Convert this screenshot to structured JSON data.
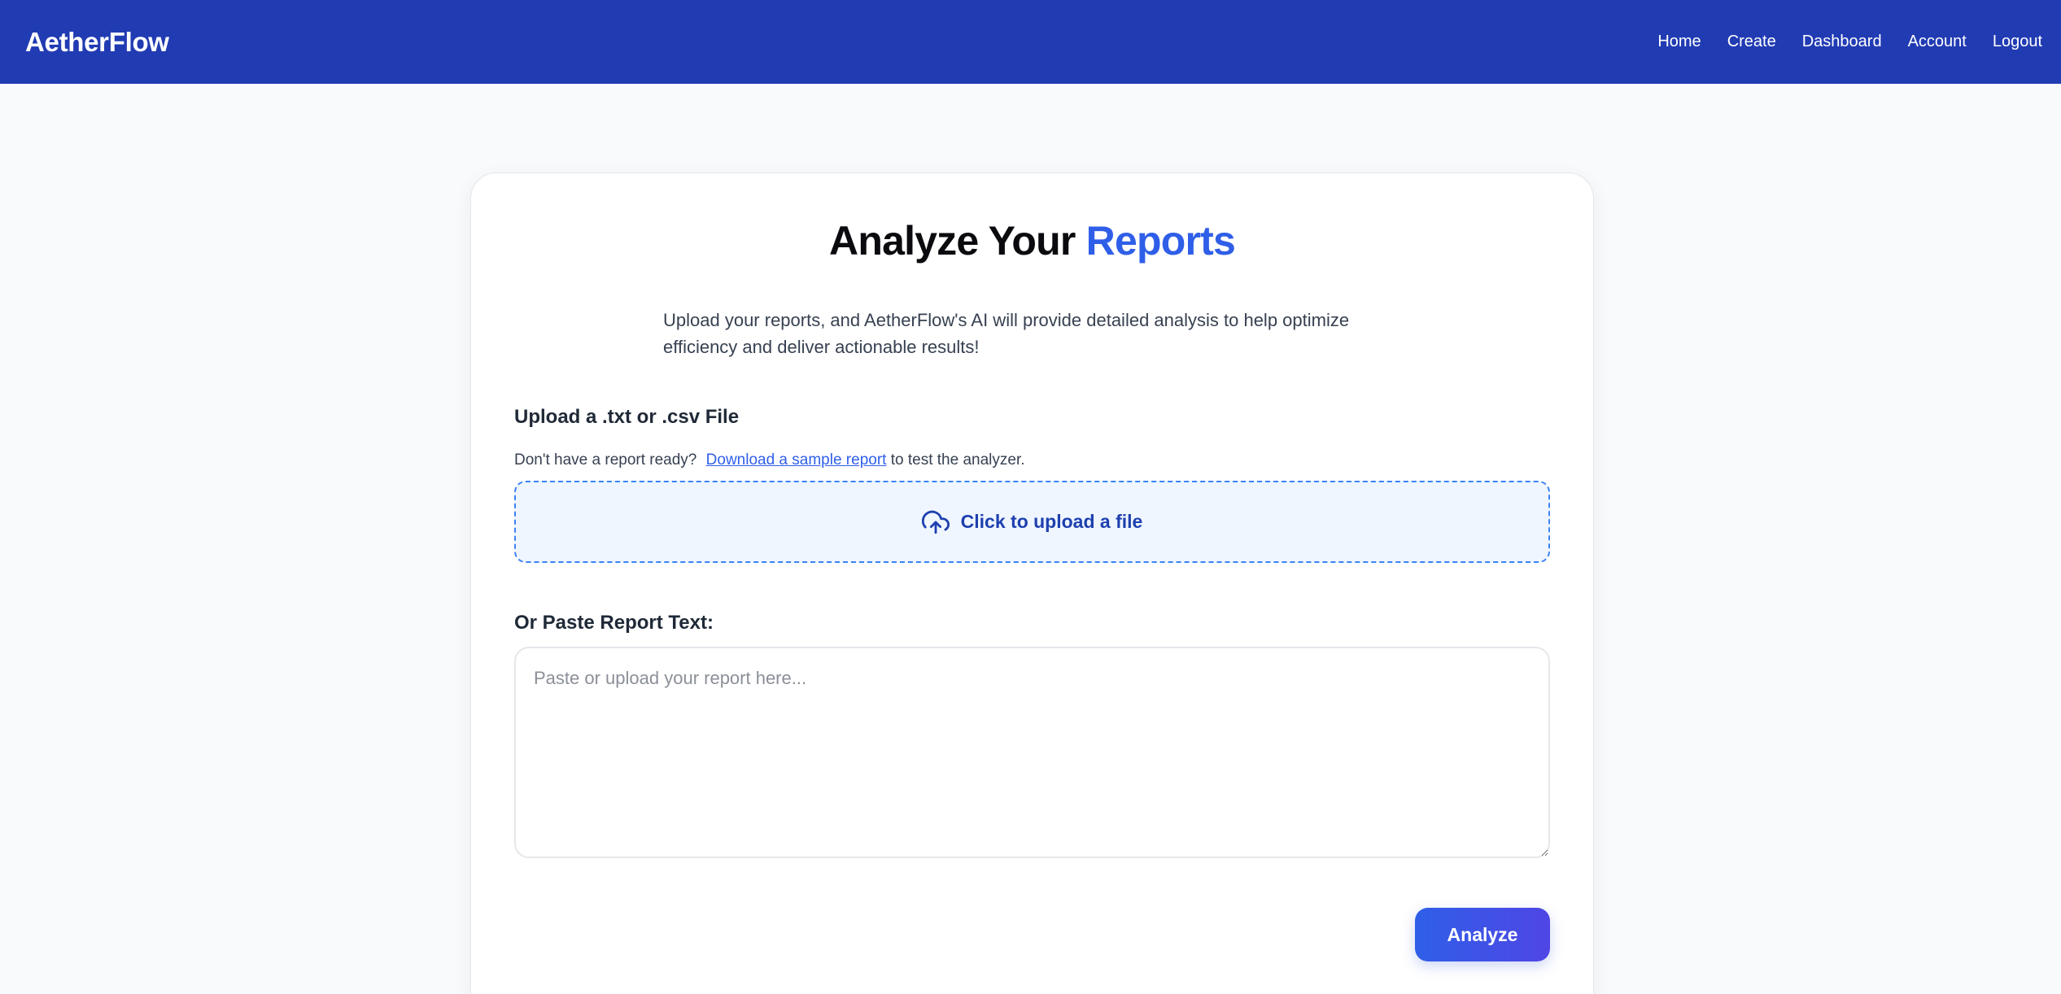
{
  "header": {
    "brand": "AetherFlow",
    "nav": [
      {
        "label": "Home"
      },
      {
        "label": "Create"
      },
      {
        "label": "Dashboard"
      },
      {
        "label": "Account"
      },
      {
        "label": "Logout"
      }
    ]
  },
  "main": {
    "title_prefix": "Analyze Your",
    "title_accent": "Reports",
    "description": "Upload your reports, and AetherFlow's AI will provide detailed analysis to help optimize efficiency and deliver actionable results!",
    "upload": {
      "label": "Upload a .txt or .csv File",
      "sample_prefix": "Don't have a report ready?",
      "sample_link": "Download a sample report",
      "sample_suffix": "to test the analyzer.",
      "dropzone_text": "Click to upload a file",
      "dropzone_icon": "cloud-upload-icon"
    },
    "paste": {
      "label": "Or Paste Report Text:",
      "placeholder": "Paste or upload your report here...",
      "value": ""
    },
    "analyze_label": "Analyze"
  },
  "colors": {
    "header_bg": "#213bb3",
    "accent": "#2f5fe8",
    "dropzone_bg": "#eff6ff",
    "dropzone_border": "#3b82f6",
    "dropzone_text": "#1e40af",
    "button_start": "#2f5fe8",
    "button_end": "#4f46e5"
  }
}
